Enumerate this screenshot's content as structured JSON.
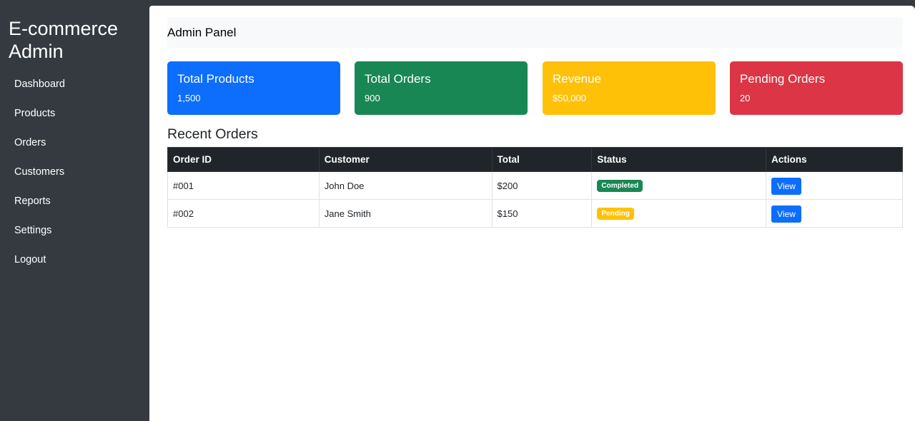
{
  "sidebar": {
    "brand_line1": "E-commerce",
    "brand_line2": "Admin",
    "items": [
      {
        "label": "Dashboard"
      },
      {
        "label": "Products"
      },
      {
        "label": "Orders"
      },
      {
        "label": "Customers"
      },
      {
        "label": "Reports"
      },
      {
        "label": "Settings"
      },
      {
        "label": "Logout"
      }
    ]
  },
  "header": {
    "title": "Admin Panel"
  },
  "cards": [
    {
      "title": "Total Products",
      "value": "1,500",
      "color": "#0d6efd"
    },
    {
      "title": "Total Orders",
      "value": "900",
      "color": "#198754"
    },
    {
      "title": "Revenue",
      "value": "$50,000",
      "color": "#ffc107"
    },
    {
      "title": "Pending Orders",
      "value": "20",
      "color": "#dc3545"
    }
  ],
  "recent_orders": {
    "title": "Recent Orders",
    "columns": [
      "Order ID",
      "Customer",
      "Total",
      "Status",
      "Actions"
    ],
    "rows": [
      {
        "id": "#001",
        "customer": "John Doe",
        "total": "$200",
        "status": "Completed",
        "action": "View"
      },
      {
        "id": "#002",
        "customer": "Jane Smith",
        "total": "$150",
        "status": "Pending",
        "action": "View"
      }
    ]
  }
}
